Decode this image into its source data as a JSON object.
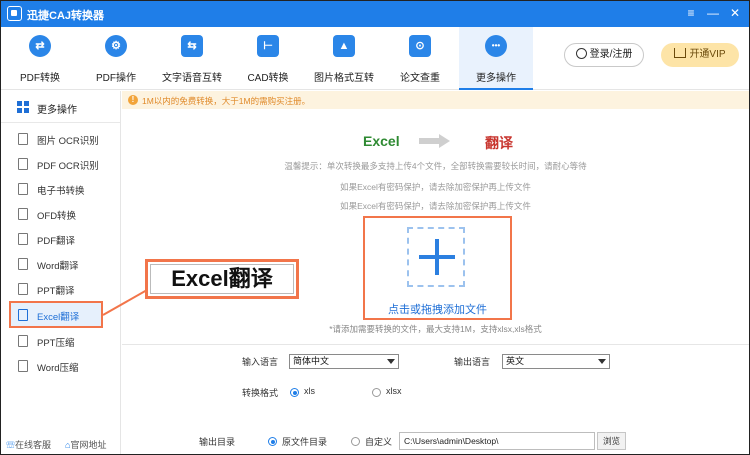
{
  "app": {
    "title": "迅捷CAJ转换器",
    "window_controls": [
      "≡",
      "—",
      "✕"
    ]
  },
  "nav": {
    "items": [
      {
        "label": "PDF转换",
        "icon": "pdf-convert-icon",
        "glyph": "⇄"
      },
      {
        "label": "PDF操作",
        "icon": "gear-icon",
        "glyph": "⚙"
      },
      {
        "label": "文字语音互转",
        "icon": "text-speech-icon",
        "glyph": "⇆"
      },
      {
        "label": "CAD转换",
        "icon": "cad-icon",
        "glyph": "⊢"
      },
      {
        "label": "图片格式互转",
        "icon": "image-icon",
        "glyph": "▲"
      },
      {
        "label": "论文查重",
        "icon": "search-doc-icon",
        "glyph": "⊙"
      },
      {
        "label": "更多操作",
        "icon": "more-icon",
        "glyph": "•••"
      }
    ],
    "active_index": 6,
    "login_label": "登录/注册",
    "vip_label": "开通VIP"
  },
  "sidebar": {
    "header_label": "更多操作",
    "items": [
      {
        "label": "图片 OCR识别"
      },
      {
        "label": "PDF OCR识别"
      },
      {
        "label": "电子书转换"
      },
      {
        "label": "OFD转换"
      },
      {
        "label": "PDF翻译"
      },
      {
        "label": "Word翻译"
      },
      {
        "label": "PPT翻译"
      },
      {
        "label": "Excel翻译"
      },
      {
        "label": "PPT压缩"
      },
      {
        "label": "Word压缩"
      }
    ],
    "active_index": 7,
    "footer_service": "在线客服",
    "footer_website": "官网地址"
  },
  "notice": {
    "text": "1M以内的免费转换，大于1M的需购买注册。"
  },
  "conversion": {
    "from": "Excel",
    "to": "翻译"
  },
  "tips": [
    "温馨提示：单次转换最多支持上传4个文件，全部转换需要较长时间，请耐心等待",
    "如果Excel有密码保护，请去除加密保护再上传文件",
    "如果Excel有密码保护，请去除加密保护再上传文件"
  ],
  "dropzone": {
    "label": "点击或拖拽添加文件",
    "note": "*请添加需要转换的文件，最大支持1M，支持xlsx,xls格式"
  },
  "settings": {
    "input_lang_label": "输入语言",
    "input_lang_value": "简体中文",
    "output_lang_label": "输出语言",
    "output_lang_value": "英文",
    "format_label": "转换格式",
    "format_options": [
      "xls",
      "xlsx"
    ],
    "format_selected": 0,
    "output_dir_label": "输出目录",
    "output_dir_options": [
      "原文件目录",
      "自定义"
    ],
    "output_dir_selected": 0,
    "output_path": "C:\\Users\\admin\\Desktop\\",
    "browse_label": "浏览"
  },
  "callout": {
    "text": "Excel翻译"
  },
  "colors": {
    "brand_blue": "#1f7ee8",
    "highlight_orange": "#f2754a",
    "excel_green": "#2e8a32",
    "translate_red": "#c8362f"
  }
}
